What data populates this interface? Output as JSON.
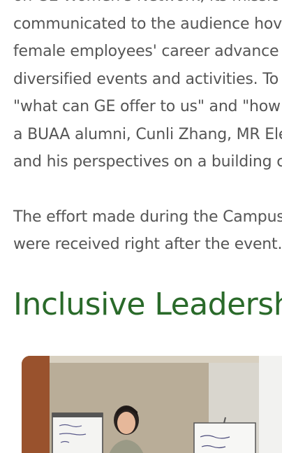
{
  "article": {
    "paragraph1": [
      "on GE Women's Network, its missio",
      "communicated to the audience hov",
      "female employees' career advance",
      "diversified events and activities. To",
      "\"what can GE offer to us\" and \"how",
      "a BUAA alumni, Cunli Zhang, MR Ele",
      "and his perspectives on a building c"
    ],
    "paragraph2": [
      "The effort made during the Campus",
      "were received right after the event."
    ],
    "heading": "Inclusive Leadersh",
    "photo": {
      "description_icon": "presentation-photo"
    }
  },
  "colors": {
    "body_text": "#555555",
    "heading": "#2a6a2a",
    "background": "#ffffff"
  }
}
